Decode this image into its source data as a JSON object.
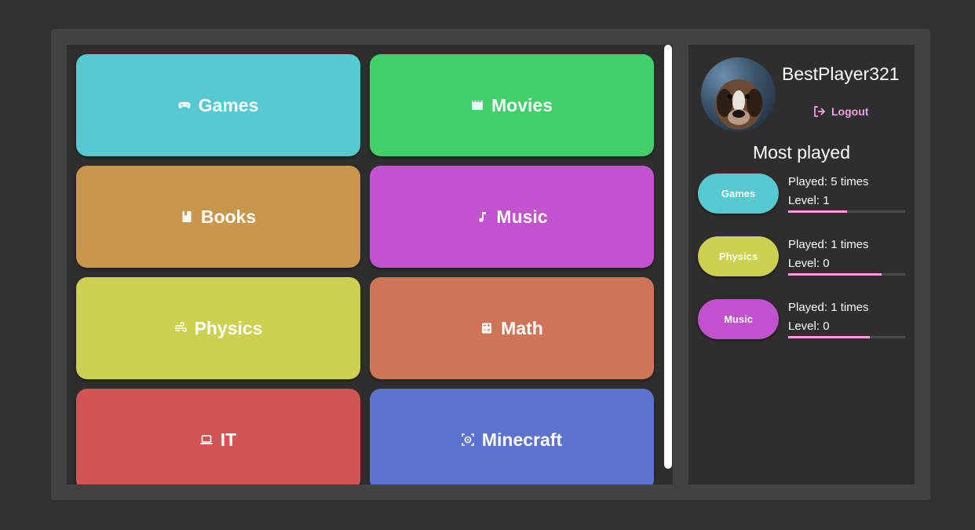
{
  "categories": [
    {
      "label": "Games",
      "icon": "gamepad-icon",
      "color": "#56c9d1"
    },
    {
      "label": "Movies",
      "icon": "clapperboard-icon",
      "color": "#41cf69"
    },
    {
      "label": "Books",
      "icon": "book-icon",
      "color": "#c9964d"
    },
    {
      "label": "Music",
      "icon": "music-note-icon",
      "color": "#c352cf"
    },
    {
      "label": "Physics",
      "icon": "wind-icon",
      "color": "#cdd152"
    },
    {
      "label": "Math",
      "icon": "calculator-icon",
      "color": "#cf7456"
    },
    {
      "label": "IT",
      "icon": "laptop-icon",
      "color": "#d05454"
    },
    {
      "label": "Minecraft",
      "icon": "minecraft-icon",
      "color": "#5973cf"
    }
  ],
  "profile": {
    "username": "BestPlayer321",
    "logout_label": "Logout"
  },
  "most_played": {
    "title": "Most played",
    "items": [
      {
        "category": "Games",
        "color": "#56c9d1",
        "played": "Played: 5 times",
        "level": "Level: 1",
        "progress": 0.5
      },
      {
        "category": "Physics",
        "color": "#cdd152",
        "played": "Played: 1 times",
        "level": "Level: 0",
        "progress": 0.8
      },
      {
        "category": "Music",
        "color": "#c352cf",
        "played": "Played: 1 times",
        "level": "Level: 0",
        "progress": 0.7
      }
    ]
  },
  "colors": {
    "accent": "#ff9fe6",
    "background": "#313131",
    "panel": "#2e2e2e",
    "frame": "#424242"
  }
}
